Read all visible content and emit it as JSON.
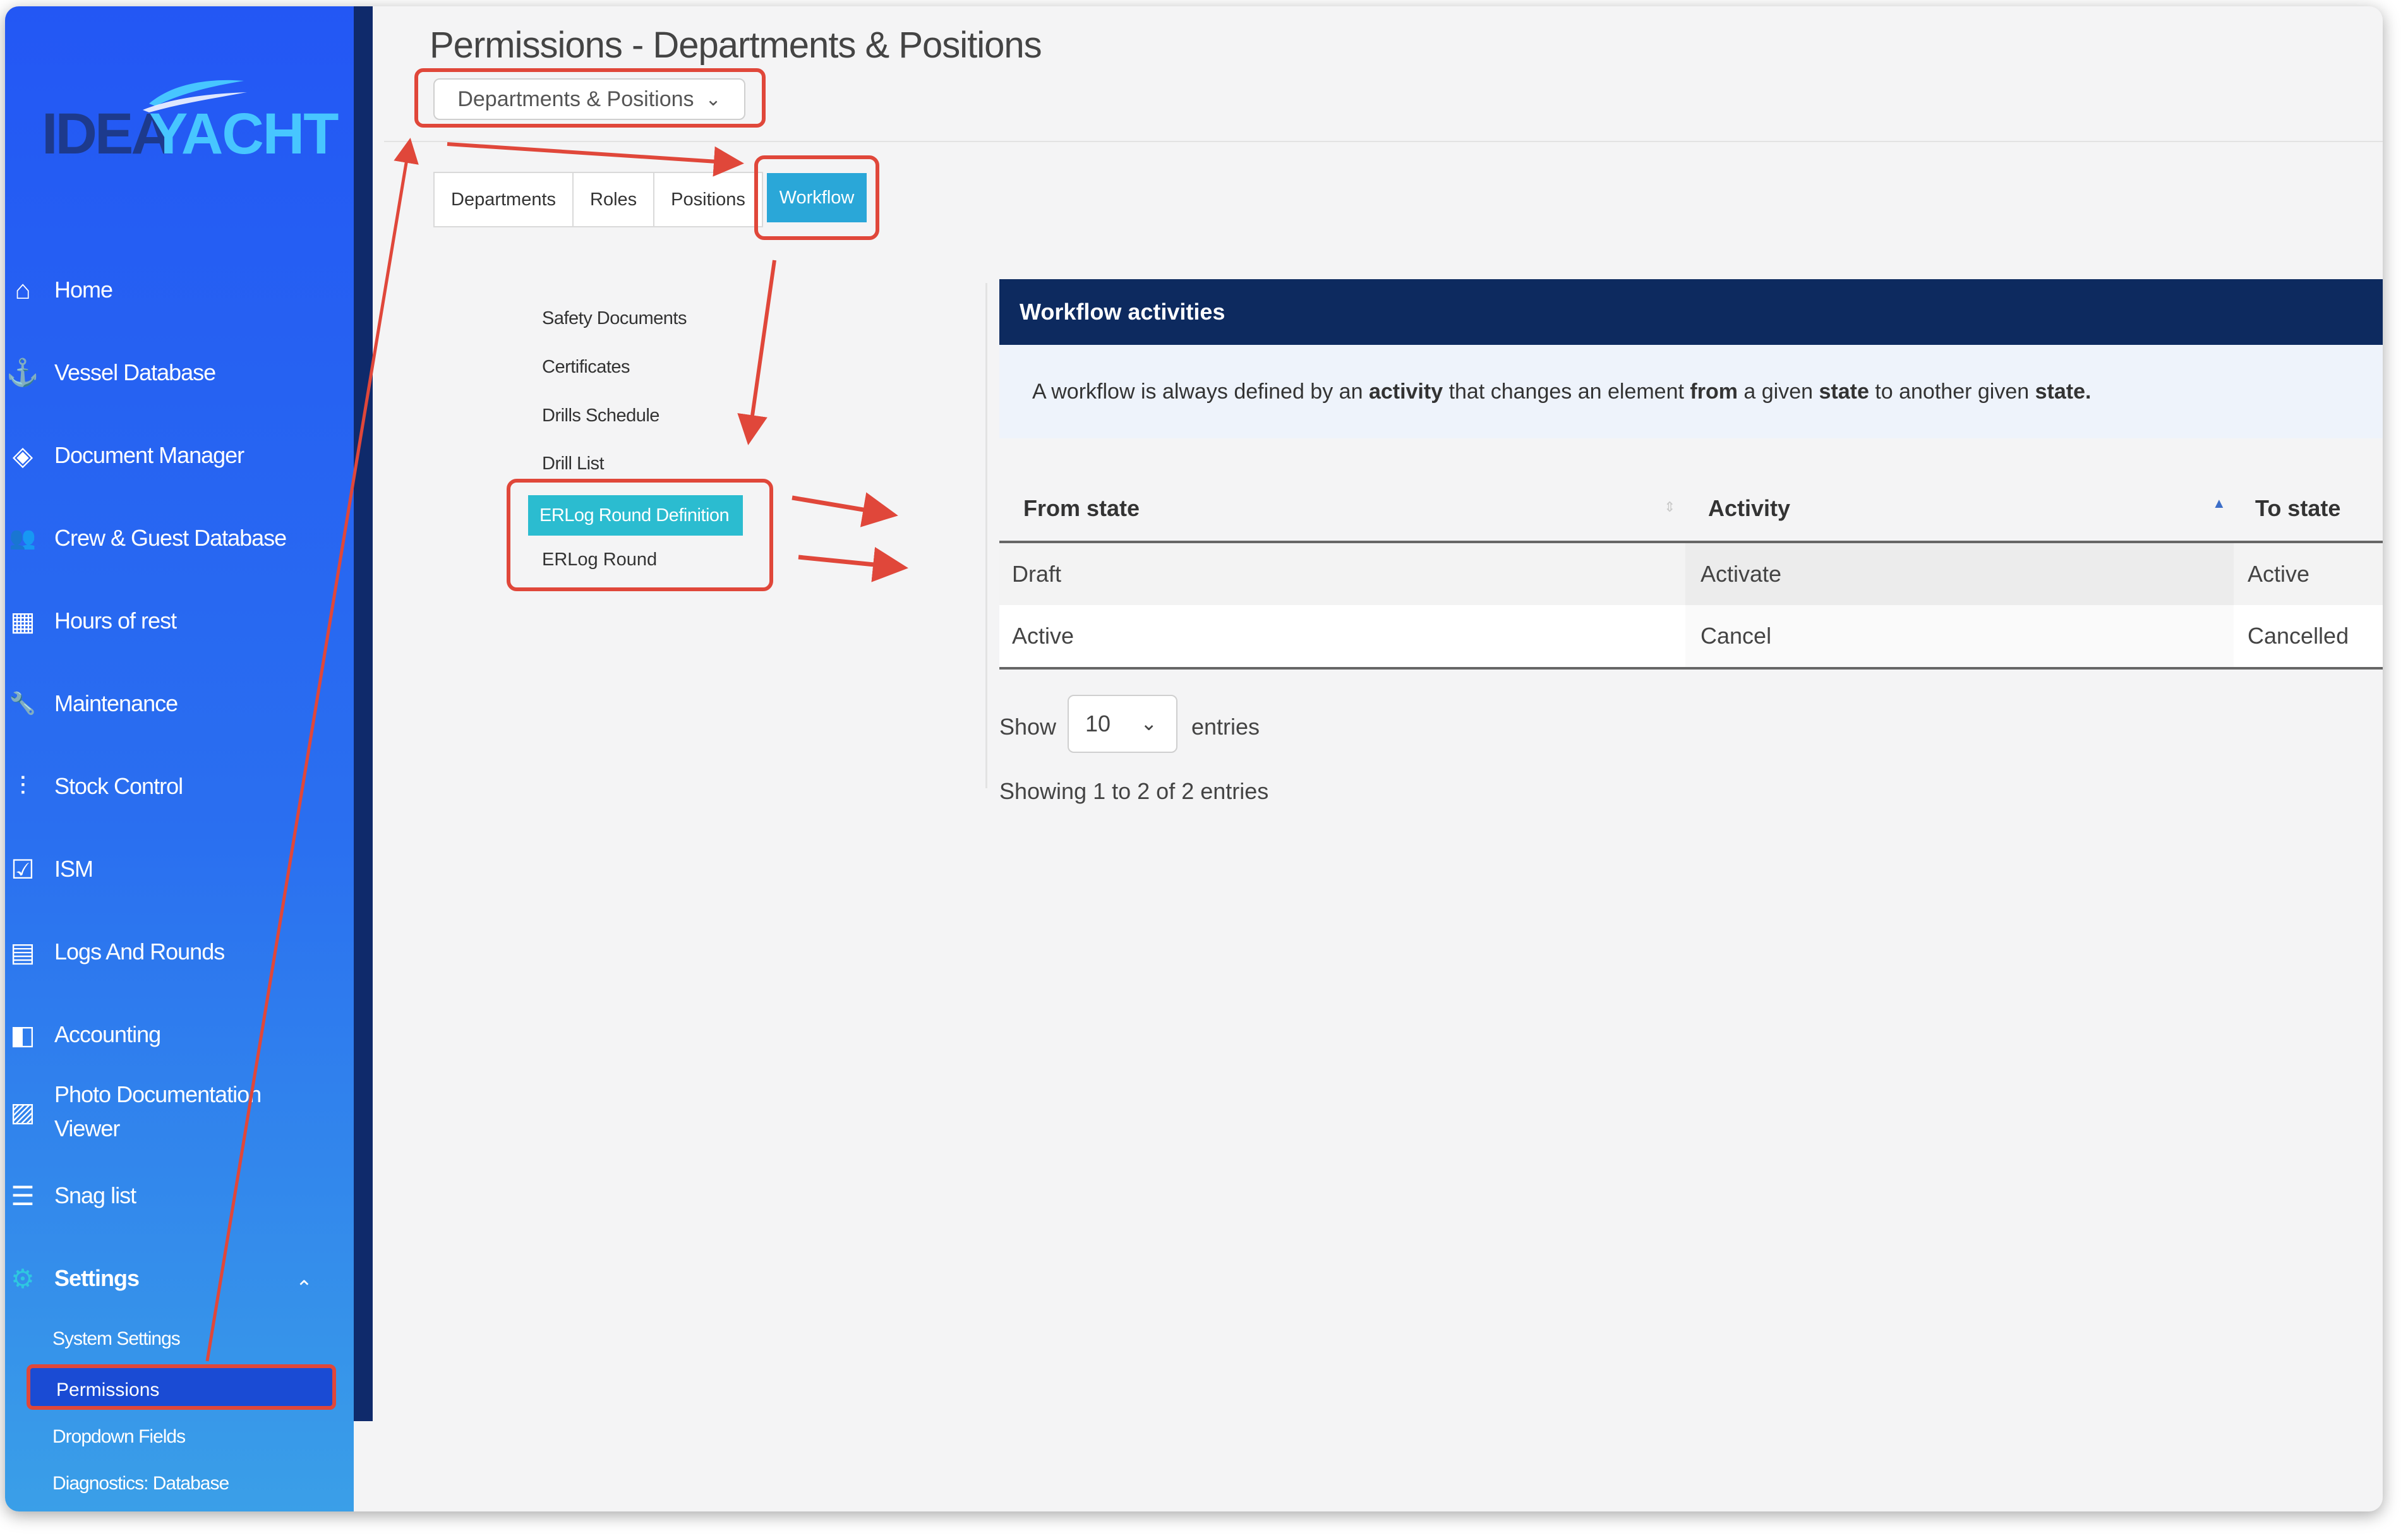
{
  "sidebar": {
    "logo": {
      "part1": "IDEA",
      "part2": "YACHT"
    },
    "items": [
      {
        "label": "Home",
        "icon": "home-icon",
        "glyph": "⌂"
      },
      {
        "label": "Vessel Database",
        "icon": "anchor-icon",
        "glyph": "⚓"
      },
      {
        "label": "Document Manager",
        "icon": "layers-icon",
        "glyph": "◈"
      },
      {
        "label": "Crew & Guest Database",
        "icon": "users-icon",
        "glyph": "👥"
      },
      {
        "label": "Hours of rest",
        "icon": "calendar-icon",
        "glyph": "▦"
      },
      {
        "label": "Maintenance",
        "icon": "wrench-icon",
        "glyph": "🔧"
      },
      {
        "label": "Stock Control",
        "icon": "sliders-icon",
        "glyph": "⫶"
      },
      {
        "label": "ISM",
        "icon": "clipboard-check-icon",
        "glyph": "☑"
      },
      {
        "label": "Logs And Rounds",
        "icon": "clipboard-list-icon",
        "glyph": "▤"
      },
      {
        "label": "Accounting",
        "icon": "book-icon",
        "glyph": "◧"
      },
      {
        "label": "Photo Documentation Viewer",
        "icon": "image-icon",
        "glyph": "▨"
      },
      {
        "label": "Snag list",
        "icon": "list-icon",
        "glyph": "☰"
      },
      {
        "label": "Settings",
        "icon": "gear-icon",
        "glyph": "⚙"
      }
    ],
    "settings_sub": [
      "System Settings",
      "Permissions",
      "Dropdown Fields",
      "Diagnostics: Database"
    ],
    "active_sub": "Permissions",
    "chevron": "⌃"
  },
  "header": {
    "title": "Permissions - Departments & Positions",
    "dropdown_value": "Departments & Positions",
    "chevron": "⌄"
  },
  "tabs": [
    "Departments",
    "Roles",
    "Positions",
    "Workflow"
  ],
  "active_tab": "Workflow",
  "entity_list": [
    "Safety Documents",
    "Certificates",
    "Drills Schedule",
    "Drill List",
    "ERLog Round Definition",
    "ERLog Round"
  ],
  "active_entity": "ERLog Round Definition",
  "panel": {
    "title": "Workflow activities",
    "description": {
      "p1": "A workflow is always defined by an ",
      "b1": "activity",
      "p2": " that changes an element ",
      "b2": "from",
      "p3": " a given ",
      "b3": "state",
      "p4": " to another given ",
      "b4": "state."
    }
  },
  "table": {
    "columns": [
      "From state",
      "Activity",
      "To state"
    ],
    "rows": [
      [
        "Draft",
        "Activate",
        "Active"
      ],
      [
        "Active",
        "Cancel",
        "Cancelled"
      ]
    ]
  },
  "pagination": {
    "show_label": "Show",
    "page_size": "10",
    "entries_label": "entries",
    "info": "Showing 1 to 2 of 2 entries"
  },
  "colors": {
    "sidebar": "#2357f4",
    "annotation": "#e0473a",
    "panel_header": "#0d2a5f",
    "active_tab": "#2aa7d8",
    "active_item": "#2bbcd0"
  }
}
